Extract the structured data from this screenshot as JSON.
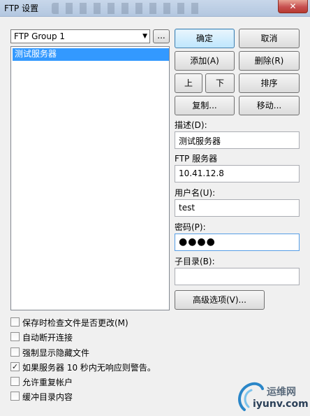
{
  "window": {
    "title": "FTP 设置",
    "close_glyph": "✕"
  },
  "group_combo": {
    "selected": "FTP Group 1",
    "arrow": "▼"
  },
  "ellipsis_button": {
    "label": "..."
  },
  "server_list": {
    "items": [
      "测试服务器"
    ]
  },
  "buttons": {
    "ok": "确定",
    "cancel": "取消",
    "add": "添加(A)",
    "delete": "删除(R)",
    "up": "上",
    "down": "下",
    "sort": "排序",
    "copy": "复制...",
    "move": "移动...",
    "advanced": "高级选项(V)..."
  },
  "form": {
    "description_label": "描述(D):",
    "description_value": "测试服务器",
    "server_label": "FTP 服务器",
    "server_value": "10.41.12.8",
    "username_label": "用户名(U):",
    "username_value": "test",
    "password_label": "密码(P):",
    "password_value": "●●●●",
    "subdir_label": "子目录(B):",
    "subdir_value": ""
  },
  "options": [
    {
      "label": "保存时检查文件是否更改(M)",
      "checked": false
    },
    {
      "label": "自动断开连接",
      "checked": false
    },
    {
      "label": "强制显示隐藏文件",
      "checked": false
    },
    {
      "label": "如果服务器 10 秒内无响应则警告。",
      "checked": true
    },
    {
      "label": "允许重复帐户",
      "checked": false
    },
    {
      "label": "缓冲目录内容",
      "checked": false
    }
  ],
  "watermark": {
    "cn": "运维网",
    "en": "iyunv.com"
  }
}
